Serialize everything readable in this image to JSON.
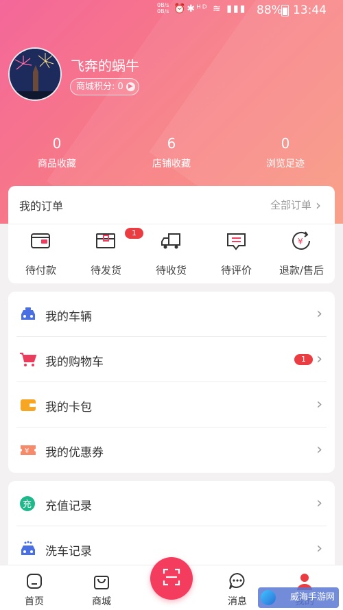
{
  "status_bar": {
    "speed_up": "0B/s",
    "speed_down": "0B/s",
    "battery": "88%",
    "time": "13:44"
  },
  "profile": {
    "name": "飞奔的蜗牛",
    "points_label": "商城积分: 0"
  },
  "stats": [
    {
      "value": "0",
      "label": "商品收藏"
    },
    {
      "value": "6",
      "label": "店铺收藏"
    },
    {
      "value": "0",
      "label": "浏览足迹"
    }
  ],
  "orders": {
    "title": "我的订单",
    "all_label": "全部订单",
    "items": [
      {
        "label": "待付款",
        "icon": "wallet-icon"
      },
      {
        "label": "待发货",
        "icon": "package-icon",
        "badge": "1"
      },
      {
        "label": "待收货",
        "icon": "truck-icon"
      },
      {
        "label": "待评价",
        "icon": "comment-icon"
      },
      {
        "label": "退款/售后",
        "icon": "refund-icon"
      }
    ]
  },
  "menu1": [
    {
      "label": "我的车辆",
      "icon": "car-icon",
      "color": "#4a6fe3"
    },
    {
      "label": "我的购物车",
      "icon": "cart-icon",
      "color": "#ea3c5c",
      "badge": "1"
    },
    {
      "label": "我的卡包",
      "icon": "card-wallet-icon",
      "color": "#f6a623"
    },
    {
      "label": "我的优惠券",
      "icon": "coupon-icon",
      "color": "#f58b6a"
    }
  ],
  "menu2": [
    {
      "label": "充值记录",
      "icon": "recharge-icon",
      "color": "#1fb88a",
      "glyph": "充"
    },
    {
      "label": "洗车记录",
      "icon": "car-wash-icon",
      "color": "#4a6fe3"
    }
  ],
  "tabbar": [
    {
      "label": "首页",
      "icon": "home-icon"
    },
    {
      "label": "商城",
      "icon": "shopping-bag-icon"
    },
    {
      "label": "消息",
      "icon": "message-icon"
    },
    {
      "label": "我的",
      "icon": "user-icon"
    }
  ],
  "watermark": "威海手游网",
  "colors": {
    "accent": "#f43c5e",
    "header_start": "#f4679a",
    "header_end": "#f99277",
    "badge": "#ea3c41"
  }
}
